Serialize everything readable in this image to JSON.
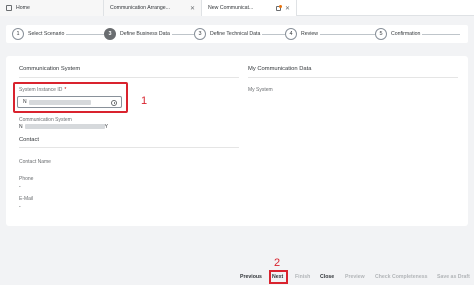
{
  "tabs": [
    {
      "label": "Home"
    },
    {
      "label": "Communication Arrange..."
    },
    {
      "label": "New Communicat..."
    }
  ],
  "wizard": {
    "steps": [
      {
        "num": "1",
        "label": "Select Scenario"
      },
      {
        "num": "3",
        "label": "Define Business Data"
      },
      {
        "num": "3",
        "label": "Define Technical Data"
      },
      {
        "num": "4",
        "label": "Review"
      },
      {
        "num": "5",
        "label": "Confirmation"
      }
    ]
  },
  "main": {
    "communication_system_title": "Communication System",
    "my_communication_data_title": "My Communication Data",
    "system_instance_label": "System Instance ID",
    "system_instance_required": "*",
    "system_instance_value_prefix": "N",
    "communication_system_label": "Communication System",
    "communication_system_value_prefix": "N",
    "communication_system_value_suffix": "Y",
    "my_system_label": "My System",
    "contact_title": "Contact",
    "contact_name_label": "Contact Name",
    "phone_label": "Phone",
    "phone_value": "-",
    "email_label": "E-Mail",
    "email_value": "-"
  },
  "annotations": {
    "one": "1",
    "two": "2"
  },
  "footer": {
    "previous": "Previous",
    "next": "Next",
    "finish": "Finish",
    "close": "Close",
    "preview": "Preview",
    "check": "Check Completeness",
    "save_draft": "Save as Draft"
  },
  "colors": {
    "annotation": "#d9232e",
    "active_step": "#6a6d70",
    "required": "#bb0000"
  }
}
